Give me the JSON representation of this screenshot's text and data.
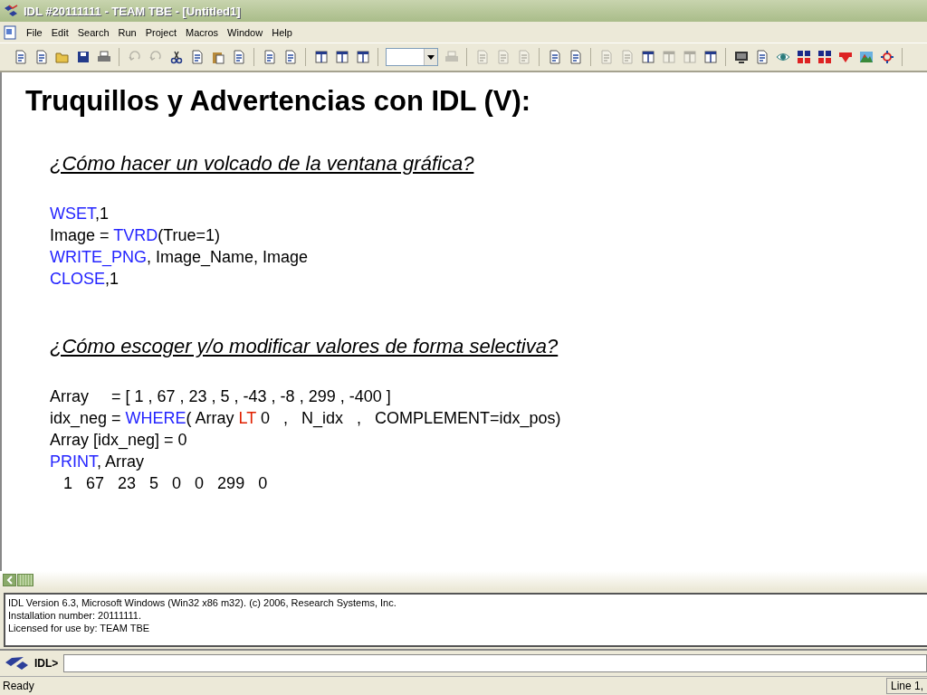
{
  "window": {
    "title": "IDL #20111111 - TEAM TBE - [Untitled1]"
  },
  "menu": [
    "File",
    "Edit",
    "Search",
    "Run",
    "Project",
    "Macros",
    "Window",
    "Help"
  ],
  "toolbar": [
    {
      "kind": "button",
      "disabled": false
    },
    {
      "kind": "button",
      "disabled": false
    },
    {
      "kind": "button",
      "disabled": false
    },
    {
      "kind": "button",
      "disabled": false
    },
    {
      "kind": "button",
      "disabled": false
    },
    {
      "kind": "separator"
    },
    {
      "kind": "button",
      "disabled": true
    },
    {
      "kind": "button",
      "disabled": true
    },
    {
      "kind": "button",
      "disabled": false
    },
    {
      "kind": "button",
      "disabled": false
    },
    {
      "kind": "button",
      "disabled": false
    },
    {
      "kind": "button",
      "disabled": false
    },
    {
      "kind": "separator"
    },
    {
      "kind": "button",
      "disabled": false
    },
    {
      "kind": "button",
      "disabled": false
    },
    {
      "kind": "separator"
    },
    {
      "kind": "button",
      "disabled": false
    },
    {
      "kind": "button",
      "disabled": false
    },
    {
      "kind": "button",
      "disabled": false
    },
    {
      "kind": "separator"
    },
    {
      "kind": "combo"
    },
    {
      "kind": "button",
      "disabled": true
    },
    {
      "kind": "separator"
    },
    {
      "kind": "button",
      "disabled": true
    },
    {
      "kind": "button",
      "disabled": true
    },
    {
      "kind": "button",
      "disabled": true
    },
    {
      "kind": "separator"
    },
    {
      "kind": "button",
      "disabled": false
    },
    {
      "kind": "button",
      "disabled": false
    },
    {
      "kind": "separator"
    },
    {
      "kind": "button",
      "disabled": true
    },
    {
      "kind": "button",
      "disabled": true
    },
    {
      "kind": "button",
      "disabled": false
    },
    {
      "kind": "button",
      "disabled": true
    },
    {
      "kind": "button",
      "disabled": true
    },
    {
      "kind": "button",
      "disabled": false
    },
    {
      "kind": "separator"
    },
    {
      "kind": "button",
      "disabled": false
    },
    {
      "kind": "button",
      "disabled": false
    },
    {
      "kind": "button",
      "disabled": false
    },
    {
      "kind": "button",
      "disabled": false
    },
    {
      "kind": "button",
      "disabled": false
    },
    {
      "kind": "button",
      "disabled": false
    },
    {
      "kind": "button",
      "disabled": false
    },
    {
      "kind": "button",
      "disabled": false
    },
    {
      "kind": "separator"
    }
  ],
  "slide": {
    "title": "Truquillos y Advertencias con IDL (V):",
    "sections": [
      {
        "heading": "¿Cómo hacer un volcado de la ventana gráfica?",
        "lines": [
          [
            {
              "kind": "keyword",
              "text": "WSET"
            },
            {
              "kind": "text",
              "text": ",1"
            }
          ],
          [
            {
              "kind": "text",
              "text": "Image = "
            },
            {
              "kind": "keyword",
              "text": "TVRD"
            },
            {
              "kind": "text",
              "text": "(True=1)"
            }
          ],
          [
            {
              "kind": "keyword",
              "text": "WRITE_PNG"
            },
            {
              "kind": "text",
              "text": ", Image_Name, Image"
            }
          ],
          [
            {
              "kind": "keyword",
              "text": "CLOSE"
            },
            {
              "kind": "text",
              "text": ",1"
            }
          ]
        ]
      },
      {
        "heading": "¿Cómo escoger y/o modificar valores de forma selectiva?",
        "lines": [
          [
            {
              "kind": "text",
              "text": "Array     = [ 1 , 67 , 23 , 5 , -43 , -8 , 299 , -400 ]"
            }
          ],
          [
            {
              "kind": "text",
              "text": "idx_neg = "
            },
            {
              "kind": "keyword",
              "text": "WHERE"
            },
            {
              "kind": "text",
              "text": "( Array "
            },
            {
              "kind": "operator",
              "text": "LT"
            },
            {
              "kind": "text",
              "text": " 0   ,   N_idx   ,   COMPLEMENT=idx_pos)"
            }
          ],
          [
            {
              "kind": "text",
              "text": "Array [idx_neg] = 0"
            }
          ],
          [
            {
              "kind": "keyword",
              "text": "PRINT"
            },
            {
              "kind": "text",
              "text": ", Array"
            }
          ],
          [
            {
              "kind": "text",
              "text": "   1   67   23   5   0   0   299   0"
            }
          ]
        ]
      }
    ]
  },
  "output": [
    "IDL Version 6.3, Microsoft Windows (Win32 x86 m32). (c) 2006, Research Systems, Inc.",
    "Installation number: 20111111.",
    "Licensed for use by: TEAM TBE"
  ],
  "command": {
    "prompt": "IDL>"
  },
  "status_bar": {
    "message": "Ready",
    "position": "Line 1,"
  }
}
